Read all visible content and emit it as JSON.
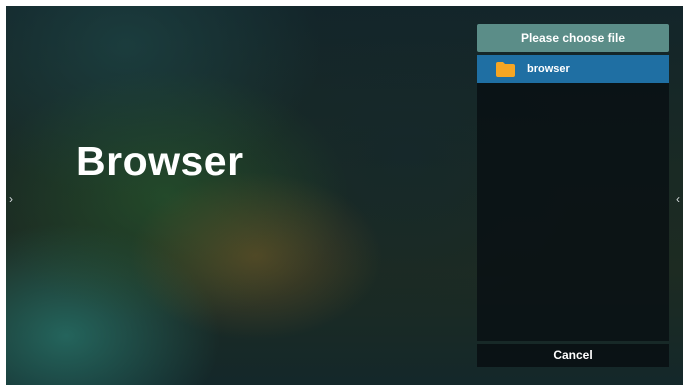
{
  "top_strip_fragment": "· ·  ·  ·    ·  ·      ·  ·   ·  ·   ·   ·   ·  ·",
  "hero": {
    "title": "Browser"
  },
  "nav": {
    "left_glyph": "›",
    "right_glyph": "‹"
  },
  "dialog": {
    "header": "Please choose file",
    "items": [
      {
        "label": "browser",
        "icon": "folder-icon",
        "selected": true
      }
    ],
    "cancel_label": "Cancel"
  },
  "colors": {
    "header_bg": "#5b8d88",
    "selected_item_bg": "#1f6fa3",
    "folder_icon": "#f5a623"
  }
}
